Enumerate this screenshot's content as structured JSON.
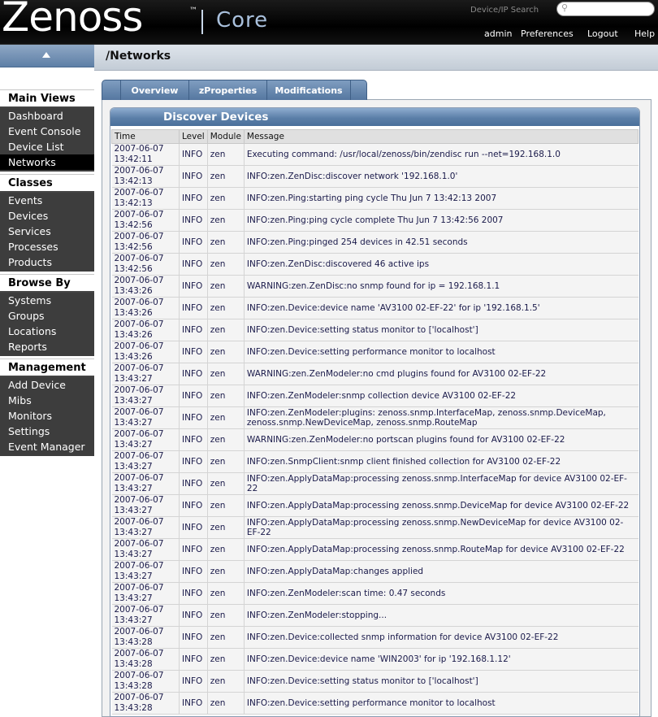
{
  "header": {
    "logo_text": "Zenoss",
    "logo_tm": "™",
    "product": "Core",
    "search_label": "Device/IP Search",
    "search_placeholder": "",
    "links": [
      "admin",
      "Preferences",
      "Logout",
      "Help"
    ]
  },
  "page": {
    "title": "/Networks"
  },
  "sidebar": {
    "sections": [
      {
        "title": "Main Views",
        "items": [
          "Dashboard",
          "Event Console",
          "Device List",
          "Networks"
        ]
      },
      {
        "title": "Classes",
        "items": [
          "Events",
          "Devices",
          "Services",
          "Processes",
          "Products"
        ]
      },
      {
        "title": "Browse By",
        "items": [
          "Systems",
          "Groups",
          "Locations",
          "Reports"
        ]
      },
      {
        "title": "Management",
        "items": [
          "Add Device",
          "Mibs",
          "Monitors",
          "Settings",
          "Event Manager"
        ]
      }
    ],
    "active_item": "Networks"
  },
  "tabs": [
    "Overview",
    "zProperties",
    "Modifications"
  ],
  "panel": {
    "title": "Discover Devices",
    "columns": [
      "Time",
      "Level",
      "Module",
      "Message"
    ],
    "rows": [
      {
        "date": "2007-06-07",
        "time": "13:42:11",
        "level": "INFO",
        "module": "zen",
        "message": "Executing command: /usr/local/zenoss/bin/zendisc run --net=192.168.1.0"
      },
      {
        "date": "2007-06-07",
        "time": "13:42:13",
        "level": "INFO",
        "module": "zen",
        "message": "INFO:zen.ZenDisc:discover network '192.168.1.0'"
      },
      {
        "date": "2007-06-07",
        "time": "13:42:13",
        "level": "INFO",
        "module": "zen",
        "message": "INFO:zen.Ping:starting ping cycle Thu Jun 7 13:42:13 2007"
      },
      {
        "date": "2007-06-07",
        "time": "13:42:56",
        "level": "INFO",
        "module": "zen",
        "message": "INFO:zen.Ping:ping cycle complete Thu Jun 7 13:42:56 2007"
      },
      {
        "date": "2007-06-07",
        "time": "13:42:56",
        "level": "INFO",
        "module": "zen",
        "message": "INFO:zen.Ping:pinged 254 devices in 42.51 seconds"
      },
      {
        "date": "2007-06-07",
        "time": "13:42:56",
        "level": "INFO",
        "module": "zen",
        "message": "INFO:zen.ZenDisc:discovered 46 active ips"
      },
      {
        "date": "2007-06-07",
        "time": "13:43:26",
        "level": "INFO",
        "module": "zen",
        "message": "WARNING:zen.ZenDisc:no snmp found for ip = 192.168.1.1"
      },
      {
        "date": "2007-06-07",
        "time": "13:43:26",
        "level": "INFO",
        "module": "zen",
        "message": "INFO:zen.Device:device name 'AV3100 02-EF-22' for ip '192.168.1.5'"
      },
      {
        "date": "2007-06-07",
        "time": "13:43:26",
        "level": "INFO",
        "module": "zen",
        "message": "INFO:zen.Device:setting status monitor to ['localhost']"
      },
      {
        "date": "2007-06-07",
        "time": "13:43:26",
        "level": "INFO",
        "module": "zen",
        "message": "INFO:zen.Device:setting performance monitor to localhost"
      },
      {
        "date": "2007-06-07",
        "time": "13:43:27",
        "level": "INFO",
        "module": "zen",
        "message": "WARNING:zen.ZenModeler:no cmd plugins found for AV3100 02-EF-22"
      },
      {
        "date": "2007-06-07",
        "time": "13:43:27",
        "level": "INFO",
        "module": "zen",
        "message": "INFO:zen.ZenModeler:snmp collection device AV3100 02-EF-22"
      },
      {
        "date": "2007-06-07",
        "time": "13:43:27",
        "level": "INFO",
        "module": "zen",
        "message": "INFO:zen.ZenModeler:plugins: zenoss.snmp.InterfaceMap, zenoss.snmp.DeviceMap, zenoss.snmp.NewDeviceMap, zenoss.snmp.RouteMap"
      },
      {
        "date": "2007-06-07",
        "time": "13:43:27",
        "level": "INFO",
        "module": "zen",
        "message": "WARNING:zen.ZenModeler:no portscan plugins found for AV3100 02-EF-22"
      },
      {
        "date": "2007-06-07",
        "time": "13:43:27",
        "level": "INFO",
        "module": "zen",
        "message": "INFO:zen.SnmpClient:snmp client finished collection for AV3100 02-EF-22"
      },
      {
        "date": "2007-06-07",
        "time": "13:43:27",
        "level": "INFO",
        "module": "zen",
        "message": "INFO:zen.ApplyDataMap:processing zenoss.snmp.InterfaceMap for device AV3100 02-EF-22"
      },
      {
        "date": "2007-06-07",
        "time": "13:43:27",
        "level": "INFO",
        "module": "zen",
        "message": "INFO:zen.ApplyDataMap:processing zenoss.snmp.DeviceMap for device AV3100 02-EF-22"
      },
      {
        "date": "2007-06-07",
        "time": "13:43:27",
        "level": "INFO",
        "module": "zen",
        "message": "INFO:zen.ApplyDataMap:processing zenoss.snmp.NewDeviceMap for device AV3100 02-EF-22"
      },
      {
        "date": "2007-06-07",
        "time": "13:43:27",
        "level": "INFO",
        "module": "zen",
        "message": "INFO:zen.ApplyDataMap:processing zenoss.snmp.RouteMap for device AV3100 02-EF-22"
      },
      {
        "date": "2007-06-07",
        "time": "13:43:27",
        "level": "INFO",
        "module": "zen",
        "message": "INFO:zen.ApplyDataMap:changes applied"
      },
      {
        "date": "2007-06-07",
        "time": "13:43:27",
        "level": "INFO",
        "module": "zen",
        "message": "INFO:zen.ZenModeler:scan time: 0.47 seconds"
      },
      {
        "date": "2007-06-07",
        "time": "13:43:27",
        "level": "INFO",
        "module": "zen",
        "message": "INFO:zen.ZenModeler:stopping..."
      },
      {
        "date": "2007-06-07",
        "time": "13:43:28",
        "level": "INFO",
        "module": "zen",
        "message": "INFO:zen.Device:collected snmp information for device AV3100 02-EF-22"
      },
      {
        "date": "2007-06-07",
        "time": "13:43:28",
        "level": "INFO",
        "module": "zen",
        "message": "INFO:zen.Device:device name 'WIN2003' for ip '192.168.1.12'"
      },
      {
        "date": "2007-06-07",
        "time": "13:43:28",
        "level": "INFO",
        "module": "zen",
        "message": "INFO:zen.Device:setting status monitor to ['localhost']"
      },
      {
        "date": "2007-06-07",
        "time": "13:43:28",
        "level": "INFO",
        "module": "zen",
        "message": "INFO:zen.Device:setting performance monitor to localhost"
      }
    ]
  }
}
